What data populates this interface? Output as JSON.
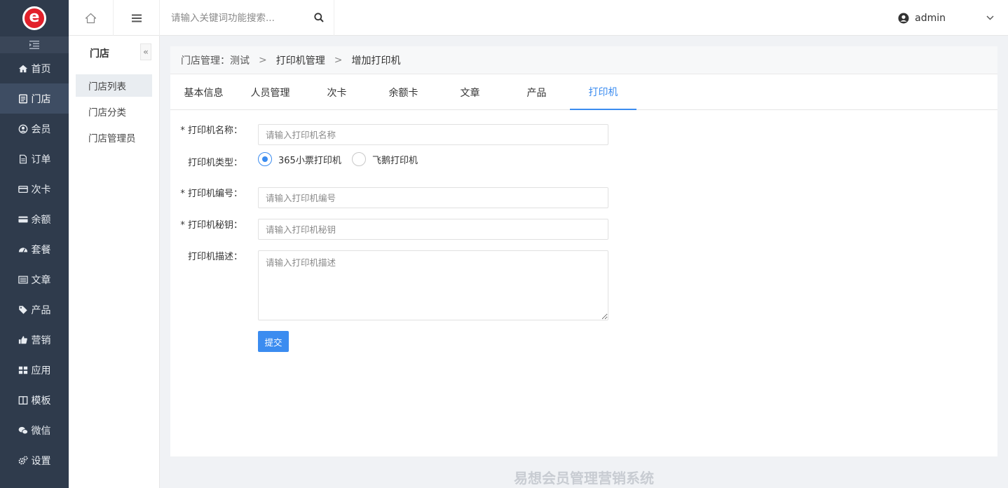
{
  "brand": {
    "logo_letter": "e"
  },
  "nav": [
    {
      "label": "首页",
      "icon": "home-icon"
    },
    {
      "label": "门店",
      "icon": "store-list-icon",
      "active": true
    },
    {
      "label": "会员",
      "icon": "user-circle-icon"
    },
    {
      "label": "订单",
      "icon": "document-icon"
    },
    {
      "label": "次卡",
      "icon": "card-icon"
    },
    {
      "label": "余额",
      "icon": "credit-card-icon"
    },
    {
      "label": "套餐",
      "icon": "dashboard-icon"
    },
    {
      "label": "文章",
      "icon": "newspaper-icon"
    },
    {
      "label": "产品",
      "icon": "tag-icon"
    },
    {
      "label": "营销",
      "icon": "thumbs-up-icon"
    },
    {
      "label": "应用",
      "icon": "grid-icon"
    },
    {
      "label": "模板",
      "icon": "columns-icon"
    },
    {
      "label": "微信",
      "icon": "wechat-icon"
    },
    {
      "label": "设置",
      "icon": "gears-icon"
    }
  ],
  "topbar": {
    "search_placeholder": "请输入关键词功能搜索...",
    "username": "admin"
  },
  "subnav": {
    "title": "门店",
    "items": [
      {
        "label": "门店列表",
        "active": true
      },
      {
        "label": "门店分类"
      },
      {
        "label": "门店管理员"
      }
    ]
  },
  "breadcrumb": {
    "items": [
      "门店管理：测试",
      "打印机管理",
      "增加打印机"
    ]
  },
  "tabs": [
    "基本信息",
    "人员管理",
    "次卡",
    "余额卡",
    "文章",
    "产品",
    "打印机"
  ],
  "form": {
    "name_label": "* 打印机名称：",
    "name_placeholder": "请输入打印机名称",
    "type_label": "打印机类型：",
    "type_options": [
      "365小票打印机",
      "飞鹅打印机"
    ],
    "type_selected": "365小票打印机",
    "number_label": "* 打印机编号：",
    "number_placeholder": "请输入打印机编号",
    "key_label": "* 打印机秘钥：",
    "key_placeholder": "请输入打印机秘钥",
    "desc_label": "打印机描述：",
    "desc_placeholder": "请输入打印机描述",
    "submit_label": "提交"
  },
  "footer": {
    "text": "易想会员管理营销系统"
  },
  "colors": {
    "sidebar": "#2f3b4c",
    "accent": "#3b8cf0",
    "logo": "#e2202a"
  }
}
